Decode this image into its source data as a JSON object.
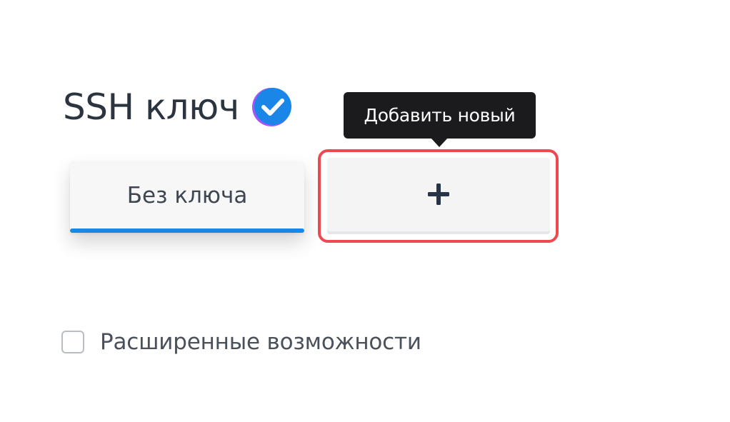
{
  "section": {
    "title": "SSH ключ",
    "verified_icon": "check-circle-icon",
    "verified_color": "#1a86e8",
    "verified_outline_color": "#a855f7"
  },
  "tooltip": {
    "text": "Добавить новый"
  },
  "key_tabs": {
    "no_key_label": "Без ключа",
    "add_icon": "plus-icon",
    "active_color": "#1a86e8"
  },
  "highlight": {
    "color": "#ec4a50"
  },
  "advanced": {
    "label": "Расширенные возможности",
    "checked": false
  }
}
